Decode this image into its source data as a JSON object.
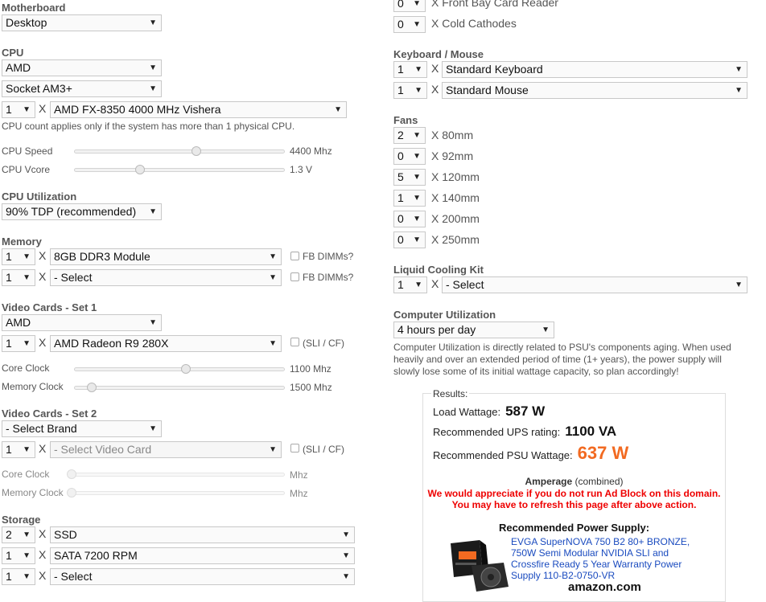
{
  "motherboard": {
    "title": "Motherboard",
    "value": "Desktop"
  },
  "cpu": {
    "title": "CPU",
    "brand": "AMD",
    "socket": "Socket AM3+",
    "count": "1",
    "x": "X",
    "model": "AMD FX-8350 4000 MHz Vishera",
    "note": "CPU count applies only if the system has more than 1 physical CPU.",
    "speed_label": "CPU Speed",
    "speed_value": "4400 Mhz",
    "speed_level": 0.58,
    "vcore_label": "CPU Vcore",
    "vcore_value": "1.3 V",
    "vcore_level": 0.31
  },
  "cpu_utilization": {
    "title": "CPU Utilization",
    "value": "90% TDP (recommended)"
  },
  "memory": {
    "title": "Memory",
    "rows": [
      {
        "count": "1",
        "x": "X",
        "module": "8GB DDR3 Module",
        "fb_label": "FB DIMMs?"
      },
      {
        "count": "1",
        "x": "X",
        "module": "- Select",
        "fb_label": "FB DIMMs?"
      }
    ]
  },
  "video1": {
    "title": "Video Cards - Set 1",
    "brand": "AMD",
    "count": "1",
    "x": "X",
    "card": "AMD Radeon R9 280X",
    "sli_label": "(SLI / CF)",
    "core_label": "Core Clock",
    "core_value": "1100 Mhz",
    "core_level": 0.53,
    "mem_label": "Memory Clock",
    "mem_value": "1500 Mhz",
    "mem_level": 0.08
  },
  "video2": {
    "title": "Video Cards - Set 2",
    "brand": "- Select Brand",
    "count": "1",
    "x": "X",
    "card": "- Select Video Card",
    "sli_label": "(SLI / CF)",
    "core_label": "Core Clock",
    "core_value": "Mhz",
    "mem_label": "Memory Clock",
    "mem_value": "Mhz"
  },
  "storage": {
    "title": "Storage",
    "rows": [
      {
        "count": "2",
        "x": "X",
        "type": "SSD"
      },
      {
        "count": "1",
        "x": "X",
        "type": "SATA 7200 RPM"
      },
      {
        "count": "1",
        "x": "X",
        "type": "- Select"
      }
    ]
  },
  "bays": {
    "front_bay": {
      "count": "0",
      "label": "X Front Bay Card Reader"
    },
    "cold_cathodes": {
      "count": "0",
      "label": "X Cold Cathodes"
    }
  },
  "keyboard_mouse": {
    "title": "Keyboard / Mouse",
    "rows": [
      {
        "count": "1",
        "x": "X",
        "type": "Standard Keyboard"
      },
      {
        "count": "1",
        "x": "X",
        "type": "Standard Mouse"
      }
    ]
  },
  "fans": {
    "title": "Fans",
    "rows": [
      {
        "count": "2",
        "label": "X 80mm"
      },
      {
        "count": "0",
        "label": "X 92mm"
      },
      {
        "count": "5",
        "label": "X 120mm"
      },
      {
        "count": "1",
        "label": "X 140mm"
      },
      {
        "count": "0",
        "label": "X 200mm"
      },
      {
        "count": "0",
        "label": "X 250mm"
      }
    ]
  },
  "liquid_cooling": {
    "title": "Liquid Cooling Kit",
    "count": "1",
    "x": "X",
    "value": "- Select"
  },
  "computer_utilization": {
    "title": "Computer Utilization",
    "value": "4 hours per day",
    "note": "Computer Utilization is directly related to PSU's components aging. When used heavily and over an extended period of time (1+ years), the power supply will slowly lose some of its initial wattage capacity, so plan accordingly!"
  },
  "results": {
    "title": "Results:",
    "load_label": "Load Wattage:",
    "load_value": "587 W",
    "ups_label": "Recommended UPS rating:",
    "ups_value": "1100 VA",
    "psu_label": "Recommended PSU Wattage:",
    "psu_value": "637 W",
    "amperage_label": "Amperage",
    "amperage_suffix": "(combined)",
    "adblock_line1": "We would appreciate if you do not run Ad Block on this domain.",
    "adblock_line2": "You may have to refresh this page after above action.",
    "rec_title": "Recommended Power Supply:",
    "rec_product": "EVGA SuperNOVA 750 B2 80+ BRONZE, 750W Semi Modular NVIDIA SLI and Crossfire Ready 5 Year Warranty Power Supply 110-B2-0750-VR",
    "store": "amazon.com"
  },
  "colors": {
    "accent_orange": "#f26a21",
    "warning_red": "#e00000",
    "link_blue": "#1a4bbf"
  },
  "icons": {
    "caret": "dropdown-caret"
  }
}
